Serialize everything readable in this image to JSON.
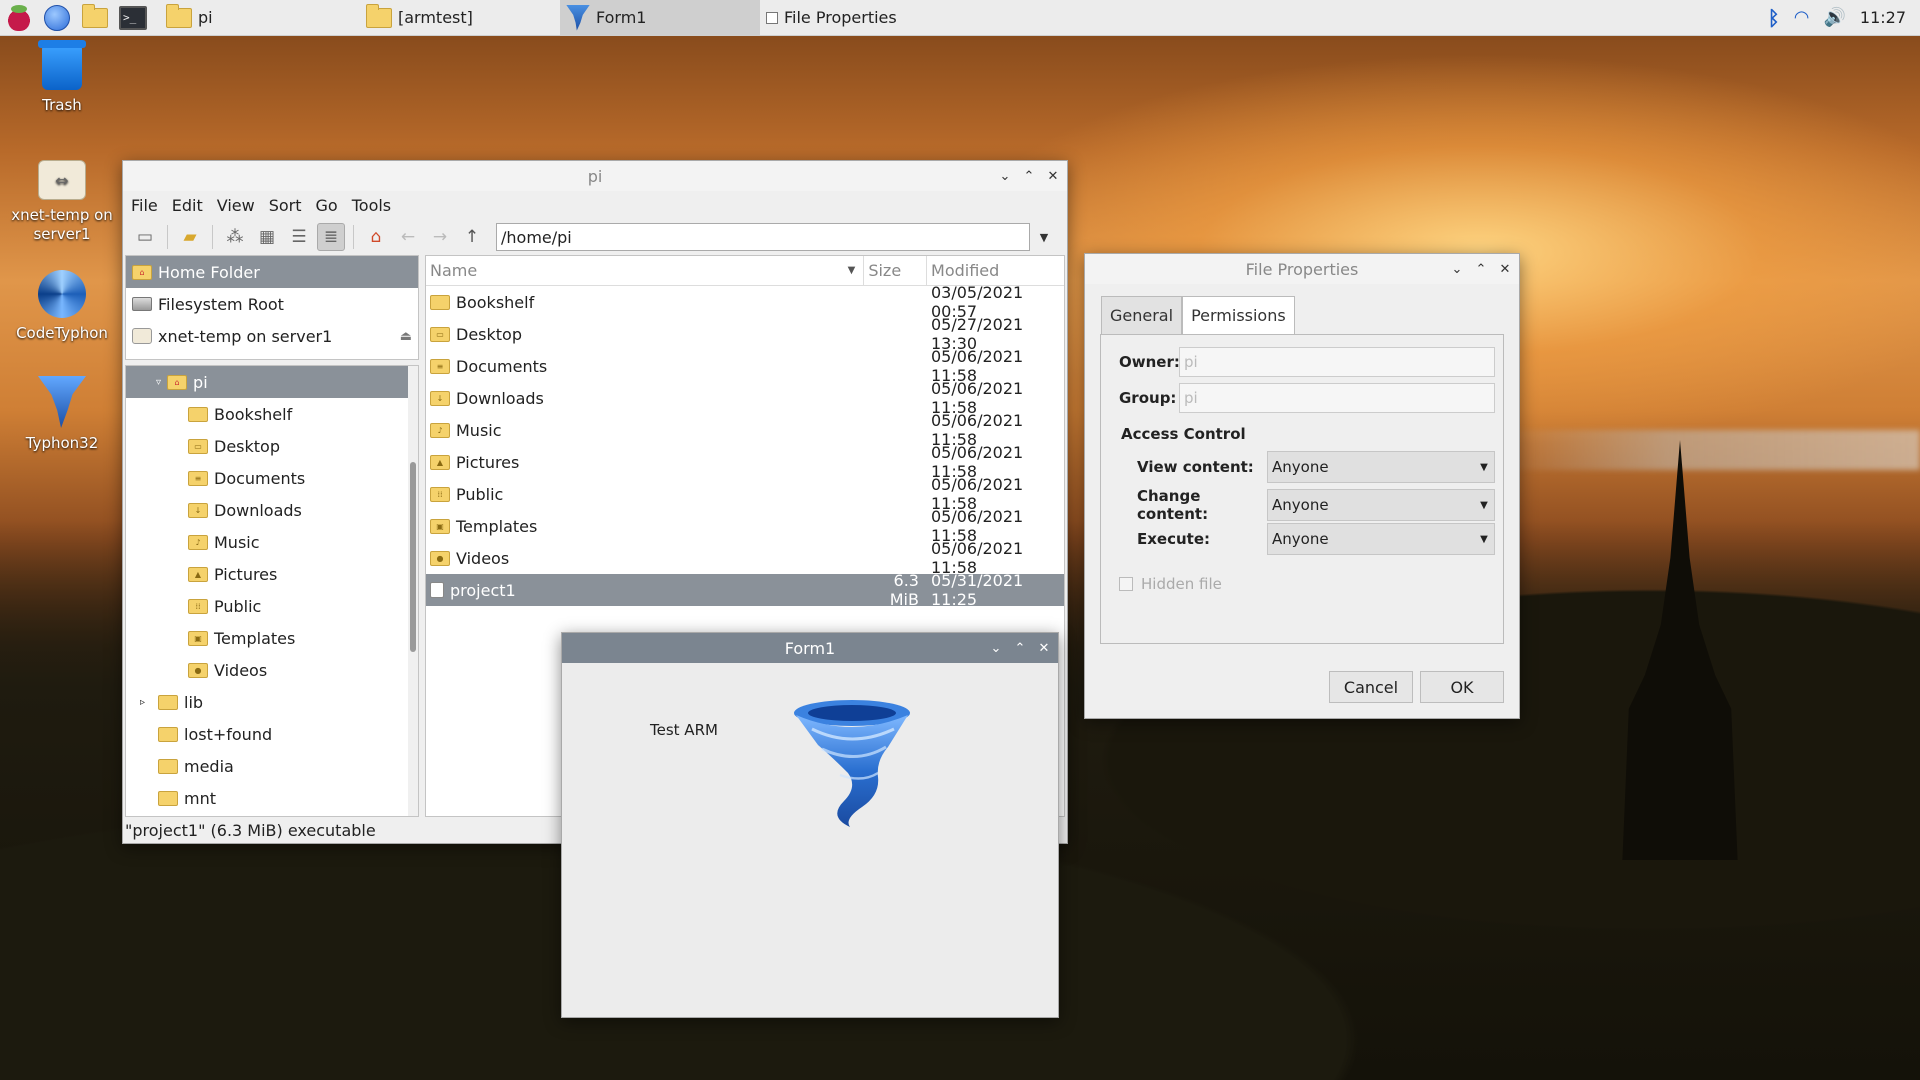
{
  "taskbar": {
    "launchers": [
      "raspberry-menu",
      "web-browser",
      "file-manager",
      "terminal"
    ],
    "tasks": [
      {
        "label": "pi"
      },
      {
        "label": "[armtest]"
      },
      {
        "label": "Form1"
      },
      {
        "label": "File Properties"
      }
    ],
    "clock": "11:27"
  },
  "desktop": {
    "icons": [
      {
        "label": "Trash"
      },
      {
        "label": "xnet-temp on server1"
      },
      {
        "label": "CodeTyphon"
      },
      {
        "label": "Typhon32"
      }
    ]
  },
  "file_manager": {
    "title": "pi",
    "menu": [
      "File",
      "Edit",
      "View",
      "Sort",
      "Go",
      "Tools"
    ],
    "path": "/home/pi",
    "places": [
      {
        "label": "Home Folder"
      },
      {
        "label": "Filesystem Root"
      },
      {
        "label": "xnet-temp on server1"
      }
    ],
    "tree": [
      {
        "label": "pi"
      },
      {
        "label": "Bookshelf"
      },
      {
        "label": "Desktop"
      },
      {
        "label": "Documents"
      },
      {
        "label": "Downloads"
      },
      {
        "label": "Music"
      },
      {
        "label": "Pictures"
      },
      {
        "label": "Public"
      },
      {
        "label": "Templates"
      },
      {
        "label": "Videos"
      },
      {
        "label": "lib"
      },
      {
        "label": "lost+found"
      },
      {
        "label": "media"
      },
      {
        "label": "mnt"
      }
    ],
    "columns": {
      "name": "Name",
      "size": "Size",
      "modified": "Modified"
    },
    "files": [
      {
        "name": "Bookshelf",
        "size": "",
        "modified": "03/05/2021 00:57"
      },
      {
        "name": "Desktop",
        "size": "",
        "modified": "05/27/2021 13:30"
      },
      {
        "name": "Documents",
        "size": "",
        "modified": "05/06/2021 11:58"
      },
      {
        "name": "Downloads",
        "size": "",
        "modified": "05/06/2021 11:58"
      },
      {
        "name": "Music",
        "size": "",
        "modified": "05/06/2021 11:58"
      },
      {
        "name": "Pictures",
        "size": "",
        "modified": "05/06/2021 11:58"
      },
      {
        "name": "Public",
        "size": "",
        "modified": "05/06/2021 11:58"
      },
      {
        "name": "Templates",
        "size": "",
        "modified": "05/06/2021 11:58"
      },
      {
        "name": "Videos",
        "size": "",
        "modified": "05/06/2021 11:58"
      },
      {
        "name": "project1",
        "size": "6.3 MiB",
        "modified": "05/31/2021 11:25"
      }
    ],
    "status": "\"project1\" (6.3 MiB) executable"
  },
  "form1": {
    "title": "Form1",
    "label": "Test ARM"
  },
  "properties": {
    "title": "File Properties",
    "tabs": [
      "General",
      "Permissions"
    ],
    "owner_label": "Owner:",
    "owner_value": "pi",
    "group_label": "Group:",
    "group_value": "pi",
    "access_heading": "Access Control",
    "view_label": "View content:",
    "view_value": "Anyone",
    "change_label": "Change content:",
    "change_value": "Anyone",
    "execute_label": "Execute:",
    "execute_value": "Anyone",
    "hidden_label": "Hidden file",
    "cancel": "Cancel",
    "ok": "OK"
  }
}
